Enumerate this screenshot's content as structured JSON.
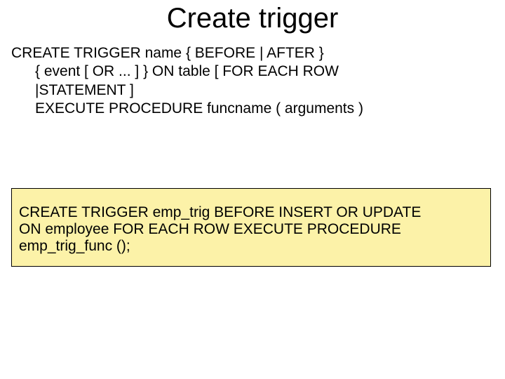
{
  "title": "Create trigger",
  "syntax": {
    "line1": "CREATE TRIGGER name  { BEFORE | AFTER }",
    "line2": "{ event [ OR ... ] } ON table [ FOR EACH ROW",
    "line3": "|STATEMENT ]",
    "line4": "EXECUTE PROCEDURE funcname ( arguments )"
  },
  "example": {
    "line1": "CREATE TRIGGER emp_trig BEFORE INSERT OR UPDATE",
    "line2": "ON employee FOR EACH ROW EXECUTE PROCEDURE",
    "line3": "emp_trig_func ();"
  }
}
